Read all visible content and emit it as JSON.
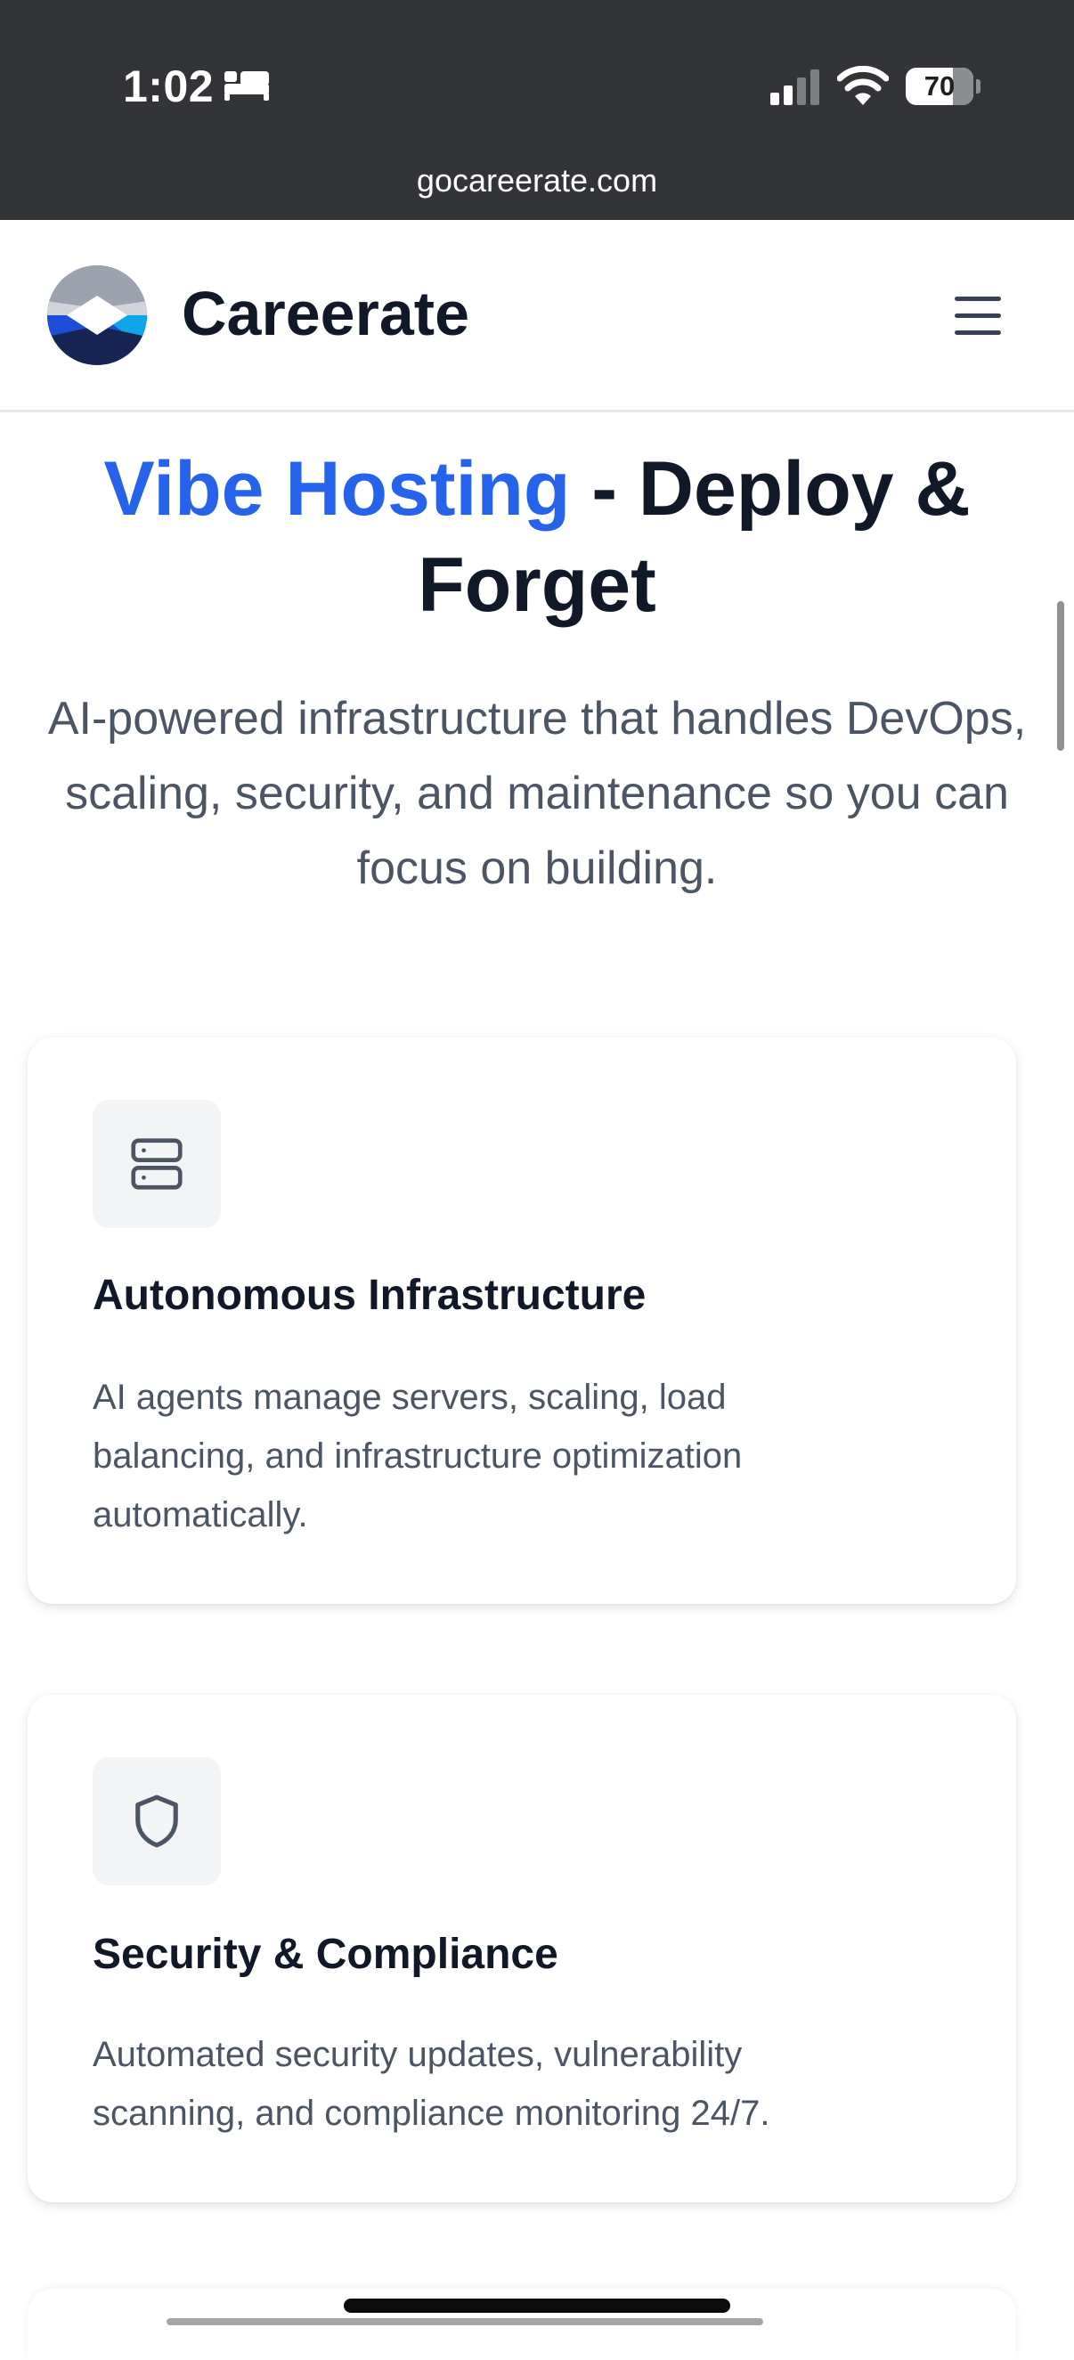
{
  "status_bar": {
    "time": "1:02",
    "battery": "70",
    "battery_level": 0.7,
    "icons": [
      "sleep-icon",
      "cellular-signal-icon",
      "wifi-icon",
      "battery-icon"
    ]
  },
  "browser": {
    "url": "gocareerate.com"
  },
  "navbar": {
    "brand": "Careerate",
    "logo_icon": "careerate-logo",
    "menu_icon": "hamburger-menu-icon"
  },
  "hero": {
    "title_accent": "Vibe Hosting",
    "title_rest": " - Deploy & Forget",
    "subtitle": "AI-powered infrastructure that handles DevOps, scaling, security, and maintenance so you can focus on building."
  },
  "features": [
    {
      "icon": "server-icon",
      "title": "Autonomous Infrastructure",
      "description": "AI agents manage servers, scaling, load balancing, and infrastructure optimization automatically."
    },
    {
      "icon": "shield-icon",
      "title": "Security & Compliance",
      "description": "Automated security updates, vulnerability scanning, and compliance monitoring 24/7."
    }
  ],
  "colors": {
    "accent": "#2563eb",
    "heading": "#111827",
    "body_text": "#4b5563",
    "status_bar_bg": "#323437"
  }
}
